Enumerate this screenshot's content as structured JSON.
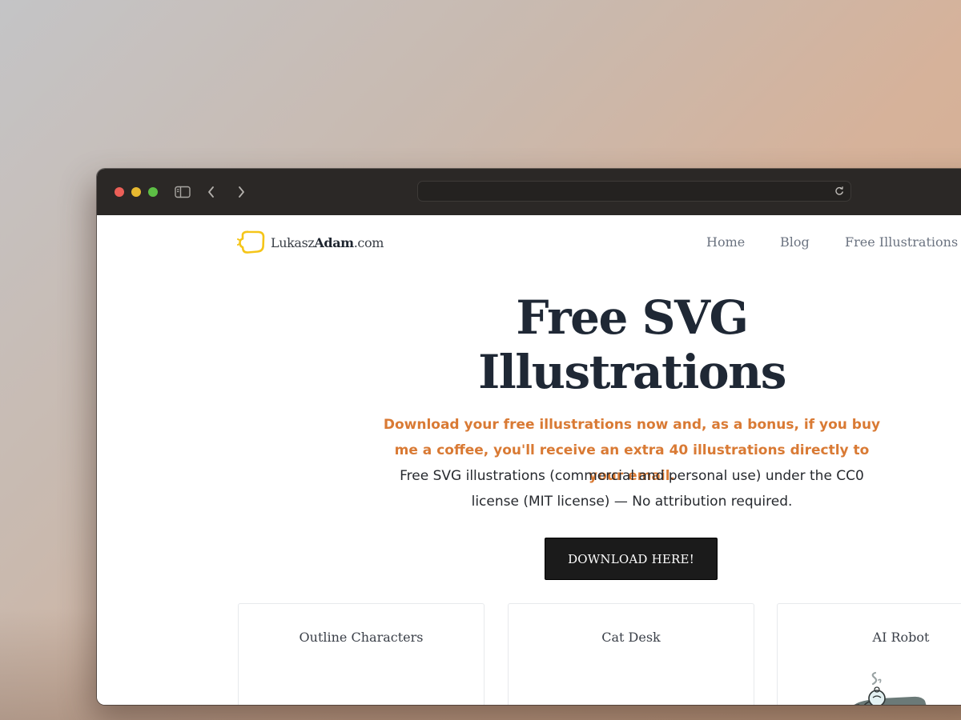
{
  "browser": {
    "address_text": ""
  },
  "site": {
    "logo_prefix": "Lukasz",
    "logo_bold": "Adam",
    "logo_suffix": ".com",
    "brand_color": "#f5c518",
    "nav": {
      "home": "Home",
      "blog": "Blog",
      "free": "Free Illustrations"
    }
  },
  "hero": {
    "title_line1": "Free SVG",
    "title_line2": "Illustrations",
    "promo": "Download your free illustrations now and, as a bonus, if you buy me a coffee, you'll receive an extra 40 illustrations directly to your email.",
    "description": "Free SVG illustrations (commercial and personal use) under the CC0 license (MIT license) — No attribution required.",
    "cta": "DOWNLOAD HERE!",
    "accent_color": "#d97a34"
  },
  "cards": [
    {
      "title": "Outline Characters"
    },
    {
      "title": "Cat Desk"
    },
    {
      "title": "AI Robot"
    }
  ],
  "icons": {
    "sidebar": "sidebar-icon",
    "back": "chevron-left-icon",
    "forward": "chevron-right-icon",
    "reload": "reload-icon"
  }
}
